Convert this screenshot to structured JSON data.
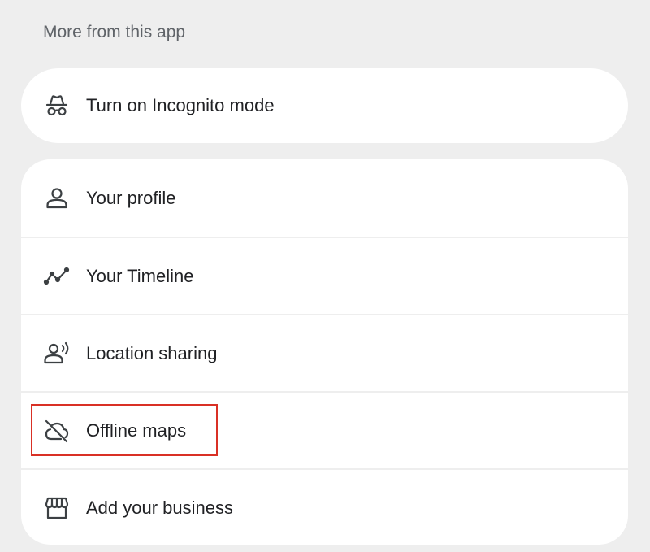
{
  "section": {
    "title": "More from this app"
  },
  "incognito": {
    "label": "Turn on Incognito mode",
    "icon": "incognito-icon"
  },
  "menu": {
    "items": [
      {
        "label": "Your profile",
        "icon": "person-icon"
      },
      {
        "label": "Your Timeline",
        "icon": "timeline-icon"
      },
      {
        "label": "Location sharing",
        "icon": "location-sharing-icon"
      },
      {
        "label": "Offline maps",
        "icon": "cloud-off-icon",
        "highlighted": true
      },
      {
        "label": "Add your business",
        "icon": "storefront-icon"
      }
    ]
  },
  "colors": {
    "background": "#eeeeee",
    "card": "#ffffff",
    "text": "#202124",
    "secondary_text": "#5f6368",
    "highlight": "#d93025"
  }
}
